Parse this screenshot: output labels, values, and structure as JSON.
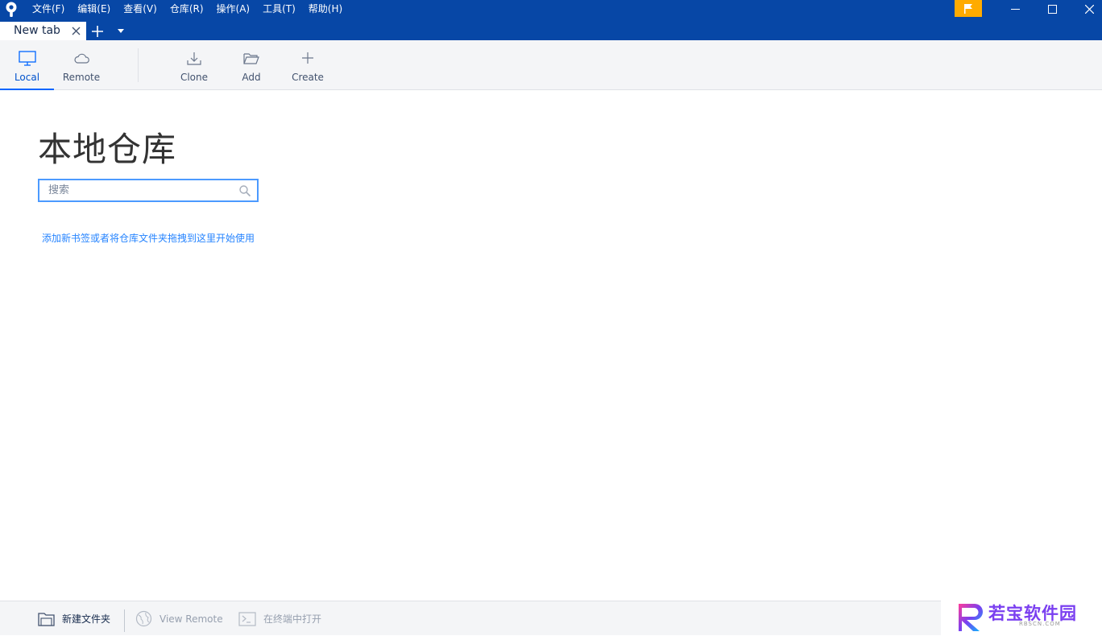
{
  "app": {
    "icon": "sourcetree-icon"
  },
  "menubar": {
    "items": [
      "文件(F)",
      "编辑(E)",
      "查看(V)",
      "仓库(R)",
      "操作(A)",
      "工具(T)",
      "帮助(H)"
    ]
  },
  "window_controls": {
    "flag_color": "#ffab00"
  },
  "tabs": {
    "items": [
      {
        "label": "New tab"
      }
    ]
  },
  "toolbar": {
    "local_label": "Local",
    "remote_label": "Remote",
    "clone_label": "Clone",
    "add_label": "Add",
    "create_label": "Create"
  },
  "main": {
    "title": "本地仓库",
    "search_placeholder": "搜索",
    "search_value": "",
    "hint_link": "添加新书签或者将仓库文件夹拖拽到这里开始使用"
  },
  "statusbar": {
    "new_folder_label": "新建文件夹",
    "view_remote_label": "View Remote",
    "open_terminal_label": "在终端中打开"
  },
  "watermark": {
    "text": "若宝软件园",
    "sub": "RBSCN.COM"
  },
  "colors": {
    "titlebar": "#0747a6",
    "accent": "#0065ff",
    "link": "#2684ff",
    "flag": "#ffab00"
  }
}
